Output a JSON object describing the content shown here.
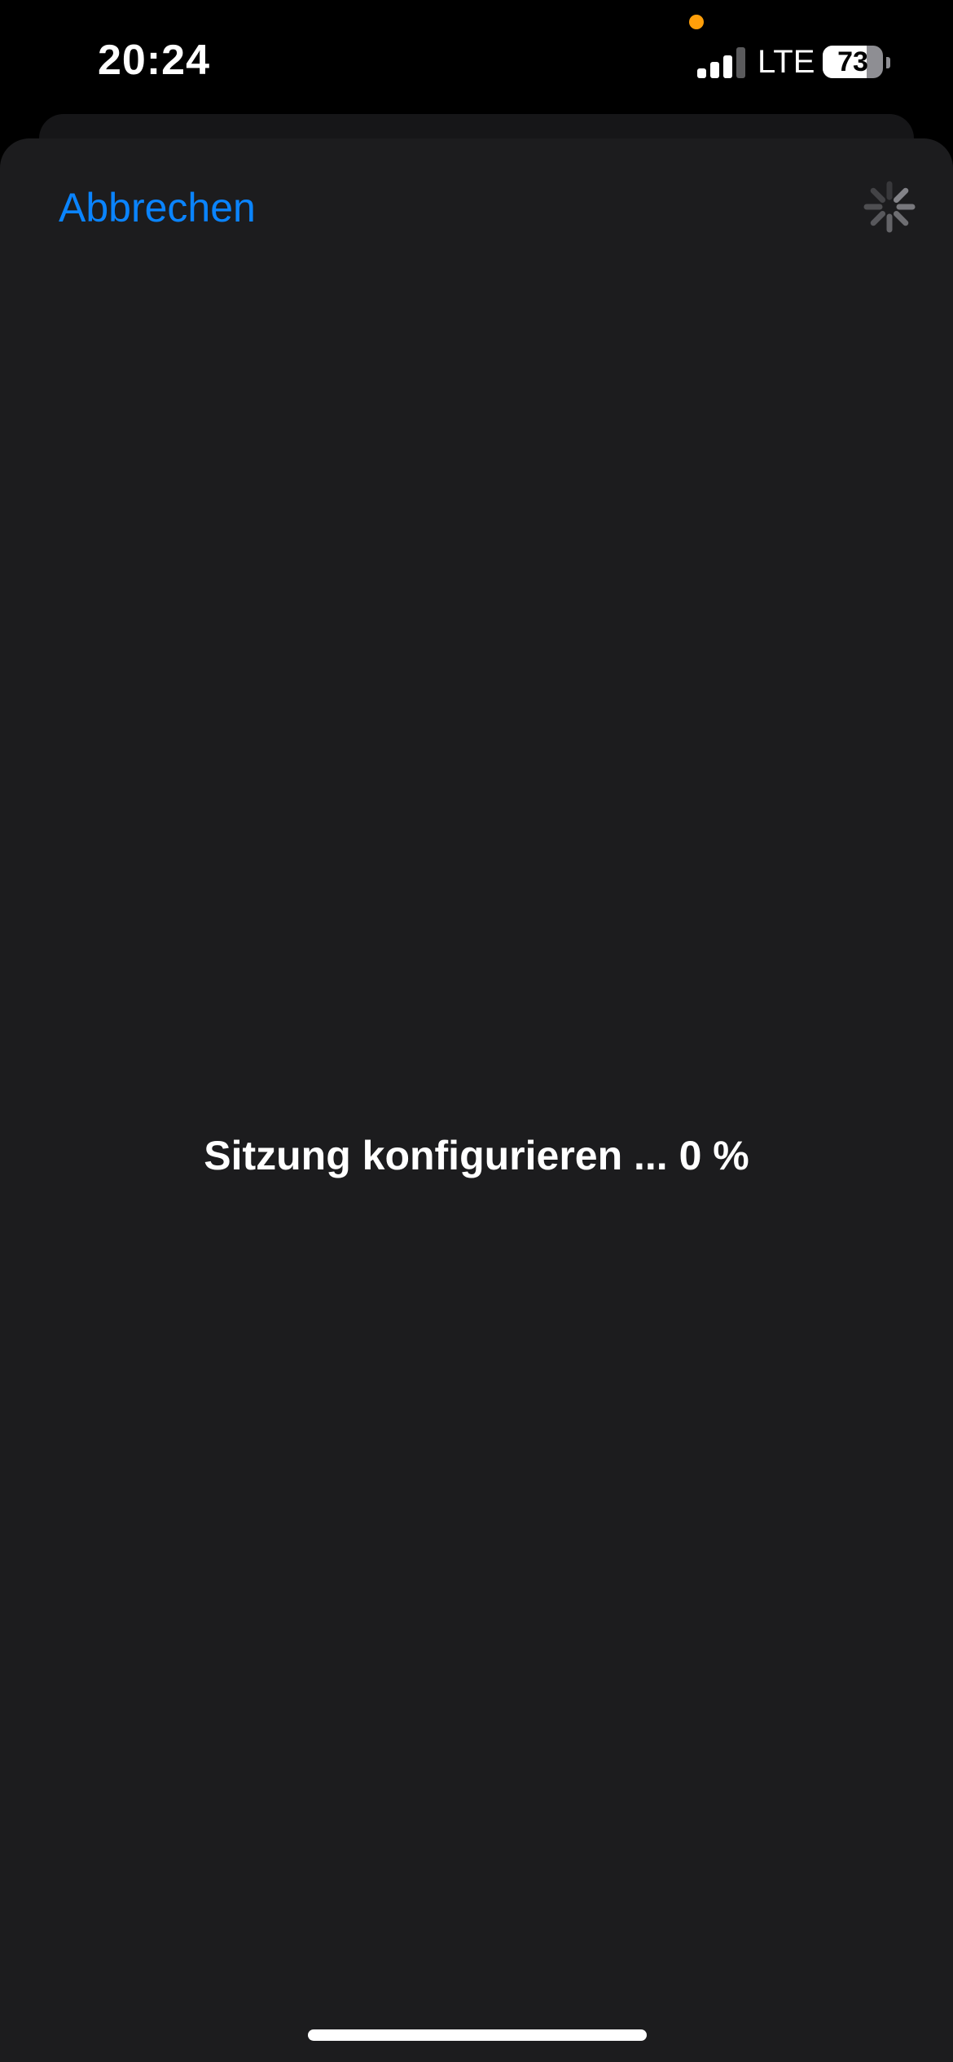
{
  "status_bar": {
    "time": "20:24",
    "network": "LTE",
    "battery_level": "73",
    "battery_fraction": 0.73,
    "signal_bars_active": 3,
    "signal_bars_total": 4,
    "mic_indicator_color": "#ff9f0a"
  },
  "sheet": {
    "cancel_label": "Abbrechen",
    "status_message": "Sitzung konfigurieren ... 0 %",
    "progress_percent": 0,
    "loading": true
  },
  "colors": {
    "accent": "#0a84ff",
    "sheet_background": "#1c1c1e",
    "background": "#000000"
  }
}
